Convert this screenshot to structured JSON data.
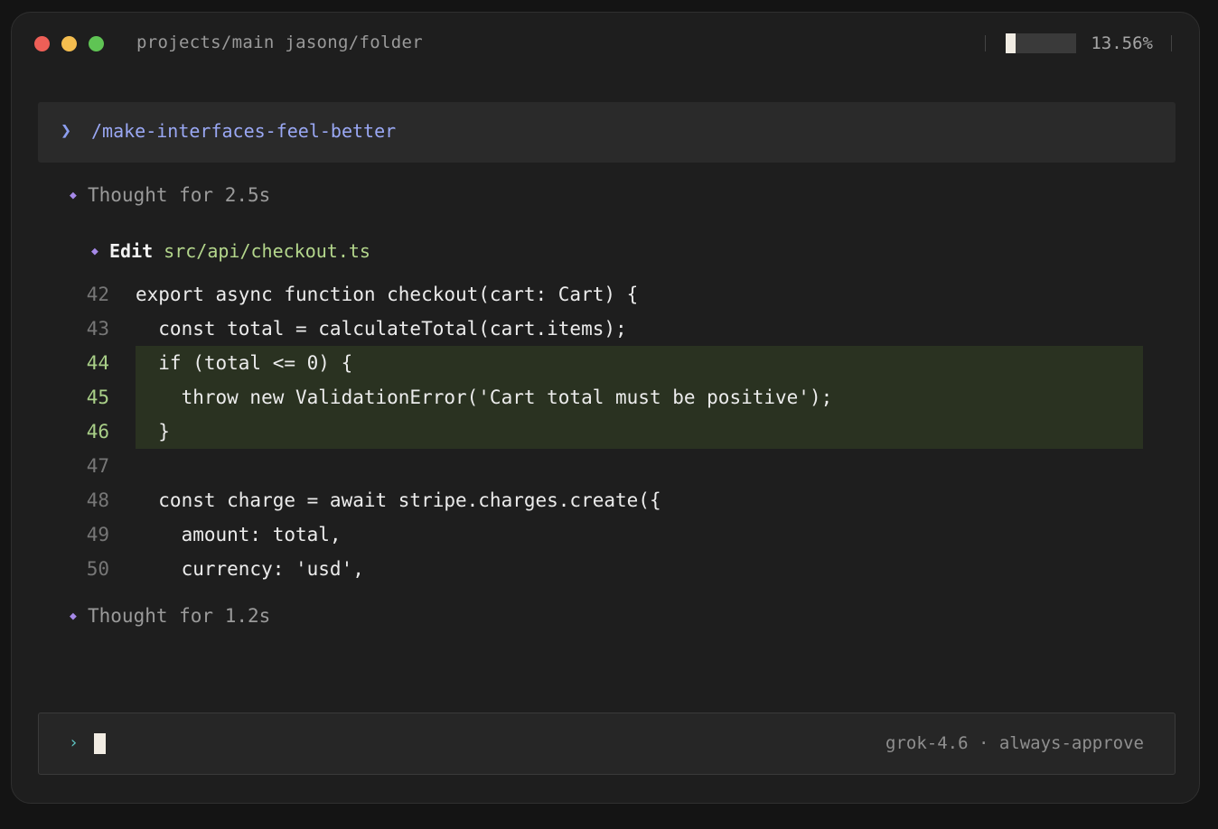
{
  "title_bar": {
    "path": "projects/main jasong/folder",
    "usage_percent_label": "13.56%",
    "usage_fraction": 0.1356
  },
  "prompt": {
    "chevron": "❯",
    "command": "/make-interfaces-feel-better"
  },
  "thoughts": [
    {
      "label": "Thought for 2.5s"
    },
    {
      "label": "Thought for 1.2s"
    }
  ],
  "edit": {
    "label": "Edit",
    "file": "src/api/checkout.ts"
  },
  "code_lines": [
    {
      "num": "42",
      "text": "export async function checkout(cart: Cart) {",
      "added": false
    },
    {
      "num": "43",
      "text": "  const total = calculateTotal(cart.items);",
      "added": false
    },
    {
      "num": "44",
      "text": "  if (total <= 0) {",
      "added": true
    },
    {
      "num": "45",
      "text": "    throw new ValidationError('Cart total must be positive');",
      "added": true
    },
    {
      "num": "46",
      "text": "  }",
      "added": true
    },
    {
      "num": "47",
      "text": "",
      "added": false
    },
    {
      "num": "48",
      "text": "  const charge = await stripe.charges.create({",
      "added": false
    },
    {
      "num": "49",
      "text": "    amount: total,",
      "added": false
    },
    {
      "num": "50",
      "text": "    currency: 'usd',",
      "added": false
    }
  ],
  "input": {
    "chevron": "›",
    "status": "grok-4.6 · always-approve"
  },
  "icons": {
    "diamond": "diamond-bullet-icon",
    "traffic_lights": [
      "close-icon",
      "minimize-icon",
      "maximize-icon"
    ]
  },
  "colors": {
    "added_bg": "#2a3221",
    "added_num": "#a9cf88",
    "accent_purple": "#a689e8",
    "command_blue": "#9aa8f4",
    "file_green": "#b4d78c",
    "prompt_teal": "#5ec4c2"
  }
}
